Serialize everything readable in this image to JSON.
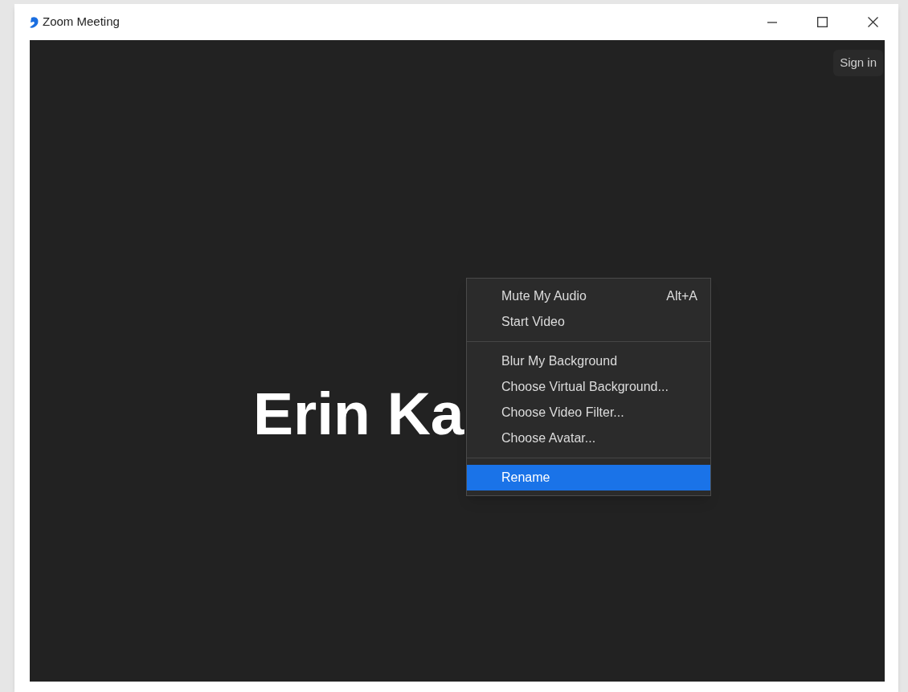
{
  "window": {
    "title": "Zoom Meeting"
  },
  "sign_in": "Sign in",
  "participant_name": "Erin Ka",
  "context_menu": {
    "groups": [
      {
        "items": [
          {
            "label": "Mute My Audio",
            "shortcut": "Alt+A",
            "selected": false
          },
          {
            "label": "Start Video",
            "selected": false
          }
        ]
      },
      {
        "items": [
          {
            "label": "Blur My Background",
            "selected": false
          },
          {
            "label": "Choose Virtual Background...",
            "selected": false
          },
          {
            "label": "Choose Video Filter...",
            "selected": false
          },
          {
            "label": "Choose Avatar...",
            "selected": false
          }
        ]
      },
      {
        "items": [
          {
            "label": "Rename",
            "selected": true
          }
        ]
      }
    ]
  }
}
